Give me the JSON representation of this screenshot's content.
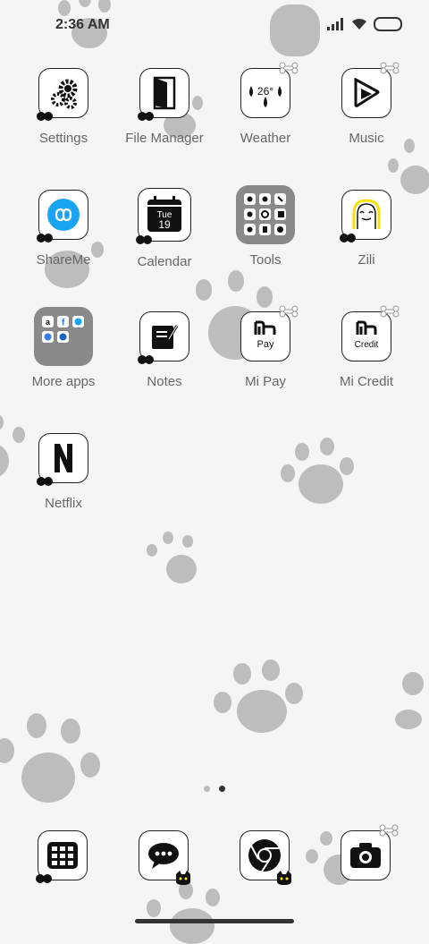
{
  "status_bar": {
    "time": "2:36 AM"
  },
  "apps": [
    {
      "label": "Settings"
    },
    {
      "label": "File Manager"
    },
    {
      "label": "Weather",
      "temp": "26°"
    },
    {
      "label": "Music"
    },
    {
      "label": "ShareMe"
    },
    {
      "label": "Calendar",
      "day": "Tue",
      "date": "19"
    },
    {
      "label": "Tools"
    },
    {
      "label": "Zili"
    },
    {
      "label": "More apps"
    },
    {
      "label": "Notes"
    },
    {
      "label": "Mi Pay",
      "icon_text": "Pay"
    },
    {
      "label": "Mi Credit",
      "icon_text": "Credit"
    },
    {
      "label": "Netflix"
    }
  ],
  "page_indicator": {
    "pages": 2,
    "current": 2
  },
  "dock": [
    "apps-grid-icon",
    "messages-icon",
    "chrome-icon",
    "camera-icon"
  ]
}
